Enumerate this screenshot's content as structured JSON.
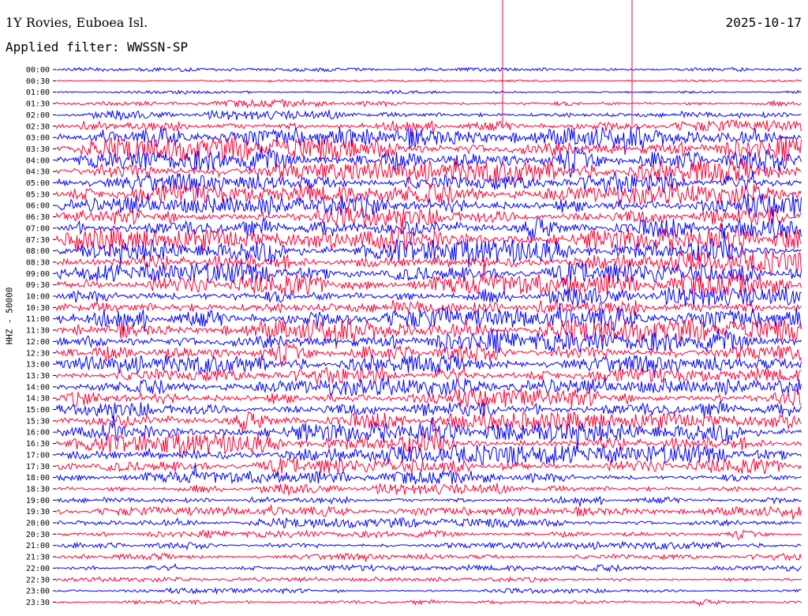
{
  "header": {
    "station": "1Y Rovies, Euboea Isl.",
    "date": "2025-10-17",
    "filter": "Applied filter: WWSSN-SP"
  },
  "chart_data": {
    "type": "line",
    "ylabel": "HHZ - 50000",
    "title": "",
    "series_colors": [
      "#0000ff",
      "#ff0033"
    ],
    "row_times": [
      "00:00",
      "00:30",
      "01:00",
      "01:30",
      "02:00",
      "02:30",
      "03:00",
      "03:30",
      "04:00",
      "04:30",
      "05:00",
      "05:30",
      "06:00",
      "06:30",
      "07:00",
      "07:30",
      "08:00",
      "08:30",
      "09:00",
      "09:30",
      "10:00",
      "10:30",
      "11:00",
      "11:30",
      "12:00",
      "12:30",
      "13:00",
      "13:30",
      "14:00",
      "14:30",
      "15:00",
      "15:30",
      "16:00",
      "16:30",
      "17:00",
      "17:30",
      "18:00",
      "18:30",
      "19:00",
      "19:30",
      "20:00",
      "20:30",
      "21:00",
      "21:30",
      "22:00",
      "22:30",
      "23:00",
      "23:30"
    ],
    "row_amplitude": [
      0.25,
      0.12,
      0.22,
      0.45,
      0.6,
      0.8,
      1.3,
      1.5,
      1.5,
      1.4,
      1.2,
      1.3,
      1.4,
      1.3,
      1.3,
      1.4,
      1.4,
      1.4,
      1.4,
      1.4,
      1.3,
      1.3,
      1.4,
      1.4,
      1.4,
      1.2,
      1.1,
      1.0,
      1.1,
      1.1,
      1.1,
      1.1,
      1.2,
      1.2,
      1.2,
      1.0,
      0.8,
      0.7,
      0.5,
      0.6,
      0.6,
      0.45,
      0.45,
      0.4,
      0.4,
      0.3,
      0.3,
      0.3
    ]
  }
}
